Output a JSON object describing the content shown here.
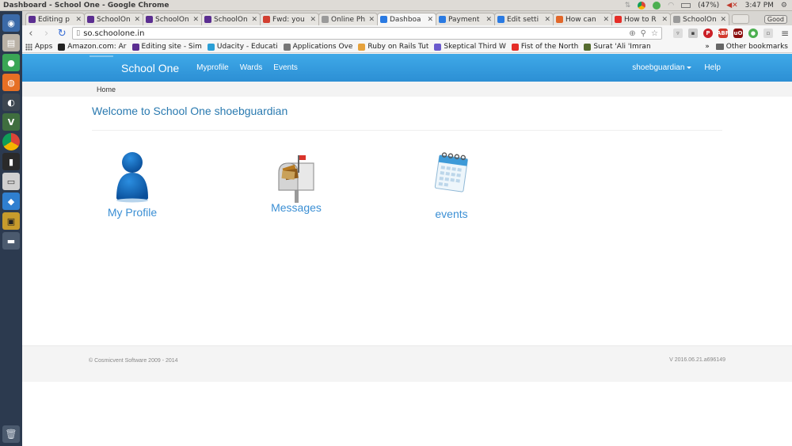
{
  "os": {
    "window_title": "Dashboard - School One - Google Chrome",
    "battery": "(47%)",
    "clock": "3:47 PM"
  },
  "browser": {
    "tabs": [
      {
        "label": "Editing p",
        "fav": "#5b2e91"
      },
      {
        "label": "SchoolOn",
        "fav": "#5b2e91"
      },
      {
        "label": "SchoolOn",
        "fav": "#5b2e91"
      },
      {
        "label": "SchoolOn",
        "fav": "#5b2e91"
      },
      {
        "label": "Fwd: you",
        "fav": "#d23f31"
      },
      {
        "label": "Online Ph",
        "fav": "#9a9a9a"
      },
      {
        "label": "Dashboa",
        "fav": "#2a7ae2"
      },
      {
        "label": "Payment",
        "fav": "#2a7ae2"
      },
      {
        "label": "Edit setti",
        "fav": "#2a7ae2"
      },
      {
        "label": "How can",
        "fav": "#e2672a"
      },
      {
        "label": "How to R",
        "fav": "#e52d27"
      },
      {
        "label": "SchoolOn",
        "fav": "#9a9a9a"
      }
    ],
    "active_tab_index": 6,
    "guest_label": "Good",
    "url": "so.schoolone.in",
    "bookmarks": [
      {
        "label": "Apps",
        "icon": "apps-grid"
      },
      {
        "label": "Amazon.com: Ar",
        "icon": "amazon-icon",
        "color": "#222222"
      },
      {
        "label": "Editing site - Sim",
        "icon": "bolt-icon",
        "color": "#5b2e91"
      },
      {
        "label": "Udacity - Educati",
        "icon": "udacity-icon",
        "color": "#2a9fd6"
      },
      {
        "label": "Applications Ove",
        "icon": "gear-icon",
        "color": "#777777"
      },
      {
        "label": "Ruby on Rails Tut",
        "icon": "rails-icon",
        "color": "#e6a23c"
      },
      {
        "label": "Skeptical Third W",
        "icon": "globe-icon",
        "color": "#6a5acd"
      },
      {
        "label": "Fist of the North",
        "icon": "youtube-icon",
        "color": "#e52d27"
      },
      {
        "label": "Surat 'Ali 'Imran",
        "icon": "quran-icon",
        "color": "#556b2f"
      }
    ],
    "bookmarks_overflow": "»",
    "other_bookmarks": "Other bookmarks"
  },
  "site": {
    "brand": "School One",
    "nav": [
      "Myprofile",
      "Wards",
      "Events"
    ],
    "user": "shoebguardian",
    "help": "Help",
    "breadcrumb": "Home",
    "welcome": "Welcome to School One shoebguardian",
    "tiles": [
      {
        "label": "My Profile",
        "icon": "person-icon"
      },
      {
        "label": "Messages",
        "icon": "mailbox-icon"
      },
      {
        "label": "events",
        "icon": "calendar-icon"
      }
    ],
    "footer_left": "© Cosmicvent Software 2009 - 2014",
    "footer_right": "V 2016.06.21.a696149"
  },
  "colors": {
    "nav_bar": "#2c8fd4",
    "welcome": "#2a7ab0",
    "tile_label": "#3b8fd4",
    "launcher": "#2c3a4f"
  }
}
